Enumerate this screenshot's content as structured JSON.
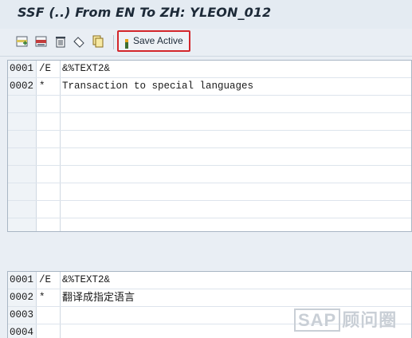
{
  "window": {
    "title": "SSF (..) From EN To ZH: YLEON_012"
  },
  "toolbar": {
    "icons": [
      "insert-line-icon",
      "insert-block-icon",
      "delete-icon",
      "undo-icon",
      "copy-icon"
    ],
    "save_active_label": "Save Active",
    "highlight_color": "#d3262b"
  },
  "source_editor": {
    "rows": [
      {
        "line": "0001",
        "format": "/E",
        "text": "&%TEXT2&"
      },
      {
        "line": "0002",
        "format": "*",
        "text": "Transaction to special languages"
      },
      {
        "line": "",
        "format": "",
        "text": ""
      },
      {
        "line": "",
        "format": "",
        "text": ""
      },
      {
        "line": "",
        "format": "",
        "text": ""
      },
      {
        "line": "",
        "format": "",
        "text": ""
      },
      {
        "line": "",
        "format": "",
        "text": ""
      },
      {
        "line": "",
        "format": "",
        "text": ""
      },
      {
        "line": "",
        "format": "",
        "text": ""
      },
      {
        "line": "",
        "format": "",
        "text": ""
      }
    ]
  },
  "target_editor": {
    "rows": [
      {
        "line": "0001",
        "format": "/E",
        "text": "&%TEXT2&"
      },
      {
        "line": "0002",
        "format": "*",
        "text": "翻译成指定语言"
      },
      {
        "line": "0003",
        "format": "",
        "text": ""
      },
      {
        "line": "0004",
        "format": "",
        "text": ""
      }
    ]
  },
  "watermark": {
    "brand": "SAP",
    "text": "顾问圈"
  }
}
